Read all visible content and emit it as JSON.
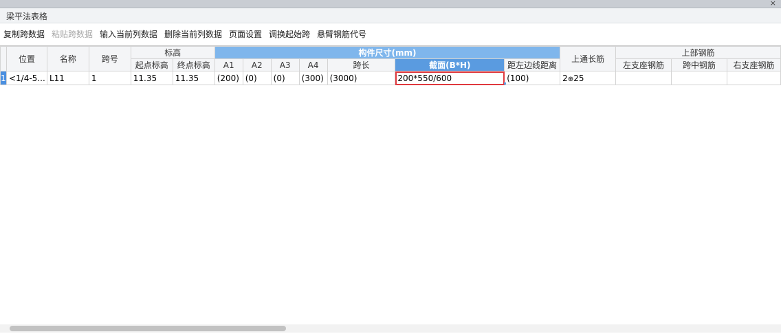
{
  "window": {
    "title": "梁平法表格",
    "close_glyph": "×"
  },
  "toolbar": {
    "copy_span": "复制跨数据",
    "paste_span": "粘贴跨数据",
    "input_column": "输入当前列数据",
    "delete_column": "删除当前列数据",
    "page_setup": "页面设置",
    "swap_start_span": "调换起始跨",
    "cantilever_code": "悬臂钢筋代号"
  },
  "table": {
    "headers": {
      "position": "位置",
      "name": "名称",
      "span_no": "跨号",
      "elevation": "标高",
      "start_elev": "起点标高",
      "end_elev": "终点标高",
      "dimensions": "构件尺寸(mm)",
      "a1": "A1",
      "a2": "A2",
      "a3": "A3",
      "a4": "A4",
      "span_length": "跨长",
      "section": "截面(B*H)",
      "left_edge_dist": "距左边线距离",
      "top_through": "上通长筋",
      "top_rebar": "上部钢筋",
      "left_support": "左支座钢筋",
      "mid_span": "跨中钢筋",
      "right_support": "右支座钢筋"
    },
    "row": {
      "row_no": "1",
      "position": "<1/4-5...",
      "name": "L11",
      "span_no": "1",
      "start_elev": "11.35",
      "end_elev": "11.35",
      "a1": "(200)",
      "a2": "(0)",
      "a3": "(0)",
      "a4": "(300)",
      "span_length": "(3000)",
      "section": "200*550/600",
      "left_edge_dist": "(100)",
      "top_through_count": "2",
      "top_through_symbol": "⊕",
      "top_through_size": "25",
      "left_support": "",
      "mid_span": "",
      "right_support": ""
    }
  },
  "colors": {
    "header_blue": "#7fb6ec",
    "header_selected": "#5a9be0",
    "active_outline": "#e0393e"
  }
}
